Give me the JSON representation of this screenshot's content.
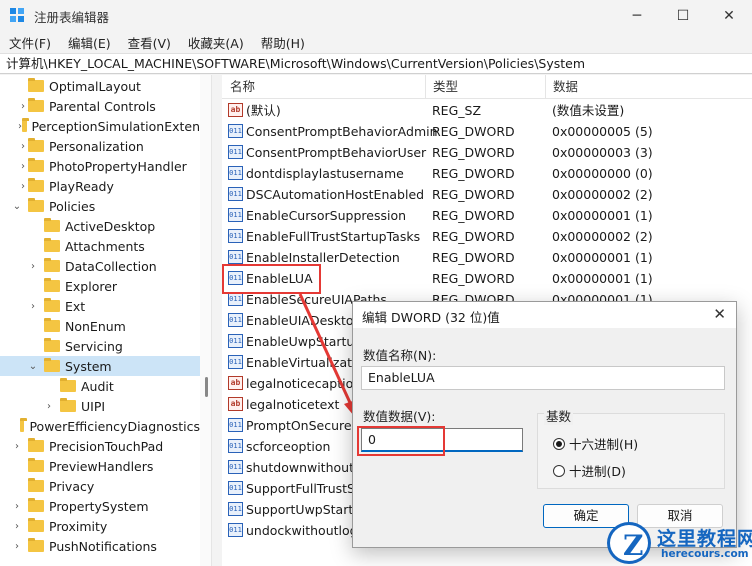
{
  "window": {
    "title": "注册表编辑器",
    "minimize": "─",
    "maximize": "☐",
    "close": "✕"
  },
  "menu": [
    "文件(F)",
    "编辑(E)",
    "查看(V)",
    "收藏夹(A)",
    "帮助(H)"
  ],
  "address": "计算机\\HKEY_LOCAL_MACHINE\\SOFTWARE\\Microsoft\\Windows\\CurrentVersion\\Policies\\System",
  "tree": [
    {
      "label": "OptimalLayout",
      "expander": ""
    },
    {
      "label": "Parental Controls",
      "expander": "›"
    },
    {
      "label": "PerceptionSimulationExten",
      "expander": "›"
    },
    {
      "label": "Personalization",
      "expander": "›"
    },
    {
      "label": "PhotoPropertyHandler",
      "expander": "›"
    },
    {
      "label": "PlayReady",
      "expander": "›"
    },
    {
      "label": "Policies",
      "expander": "⌄"
    },
    {
      "label": "ActiveDesktop",
      "expander": ""
    },
    {
      "label": "Attachments",
      "expander": ""
    },
    {
      "label": "DataCollection",
      "expander": "›"
    },
    {
      "label": "Explorer",
      "expander": ""
    },
    {
      "label": "Ext",
      "expander": "›"
    },
    {
      "label": "NonEnum",
      "expander": ""
    },
    {
      "label": "Servicing",
      "expander": ""
    },
    {
      "label": "System",
      "expander": "⌄",
      "selected": true
    },
    {
      "label": "Audit",
      "expander": ""
    },
    {
      "label": "UIPI",
      "expander": "›"
    },
    {
      "label": "PowerEfficiencyDiagnostics",
      "expander": ""
    },
    {
      "label": "PrecisionTouchPad",
      "expander": "›"
    },
    {
      "label": "PreviewHandlers",
      "expander": ""
    },
    {
      "label": "Privacy",
      "expander": ""
    },
    {
      "label": "PropertySystem",
      "expander": "›"
    },
    {
      "label": "Proximity",
      "expander": "›"
    },
    {
      "label": "PushNotifications",
      "expander": "›"
    }
  ],
  "columns": {
    "name": "名称",
    "type": "类型",
    "data": "数据"
  },
  "values": [
    {
      "name": "(默认)",
      "type": "REG_SZ",
      "data": "(数值未设置)",
      "kind": "sz"
    },
    {
      "name": "ConsentPromptBehaviorAdmin",
      "type": "REG_DWORD",
      "data": "0x00000005 (5)",
      "kind": "dword"
    },
    {
      "name": "ConsentPromptBehaviorUser",
      "type": "REG_DWORD",
      "data": "0x00000003 (3)",
      "kind": "dword"
    },
    {
      "name": "dontdisplaylastusername",
      "type": "REG_DWORD",
      "data": "0x00000000 (0)",
      "kind": "dword"
    },
    {
      "name": "DSCAutomationHostEnabled",
      "type": "REG_DWORD",
      "data": "0x00000002 (2)",
      "kind": "dword"
    },
    {
      "name": "EnableCursorSuppression",
      "type": "REG_DWORD",
      "data": "0x00000001 (1)",
      "kind": "dword"
    },
    {
      "name": "EnableFullTrustStartupTasks",
      "type": "REG_DWORD",
      "data": "0x00000002 (2)",
      "kind": "dword"
    },
    {
      "name": "EnableInstallerDetection",
      "type": "REG_DWORD",
      "data": "0x00000001 (1)",
      "kind": "dword"
    },
    {
      "name": "EnableLUA",
      "type": "REG_DWORD",
      "data": "0x00000001 (1)",
      "kind": "dword"
    },
    {
      "name": "EnableSecureUIAPaths",
      "type": "REG_DWORD",
      "data": "0x00000001 (1)",
      "kind": "dword"
    },
    {
      "name": "EnableUIADesktopToggle",
      "type": "",
      "data": "",
      "kind": "dword"
    },
    {
      "name": "EnableUwpStartupTasks",
      "type": "",
      "data": "",
      "kind": "dword"
    },
    {
      "name": "EnableVirtualization",
      "type": "",
      "data": "",
      "kind": "dword"
    },
    {
      "name": "legalnoticecaption",
      "type": "",
      "data": "",
      "kind": "sz"
    },
    {
      "name": "legalnoticetext",
      "type": "",
      "data": "",
      "kind": "sz"
    },
    {
      "name": "PromptOnSecureDesktop",
      "type": "",
      "data": "",
      "kind": "dword"
    },
    {
      "name": "scforceoption",
      "type": "",
      "data": "",
      "kind": "dword"
    },
    {
      "name": "shutdownwithoutlogon",
      "type": "",
      "data": "",
      "kind": "dword"
    },
    {
      "name": "SupportFullTrustStartupTasks",
      "type": "",
      "data": "",
      "kind": "dword"
    },
    {
      "name": "SupportUwpStartupTasks",
      "type": "",
      "data": "",
      "kind": "dword"
    },
    {
      "name": "undockwithoutlogon",
      "type": "",
      "data": "",
      "kind": "dword"
    }
  ],
  "dialog": {
    "title": "编辑 DWORD (32 位)值",
    "close": "✕",
    "name_label": "数值名称(N):",
    "name_value": "EnableLUA",
    "data_label": "数值数据(V):",
    "data_value": "0",
    "base_label": "基数",
    "hex_label": "十六进制(H)",
    "dec_label": "十进制(D)",
    "ok": "确定",
    "cancel": "取消"
  },
  "watermark": {
    "title": "这里教程网",
    "sub": "herecours.com",
    "logo": "Z"
  },
  "colors": {
    "highlight": "#e53935",
    "selected": "#cce4f7",
    "accent": "#0067c0",
    "watermark": "#1566c0"
  }
}
